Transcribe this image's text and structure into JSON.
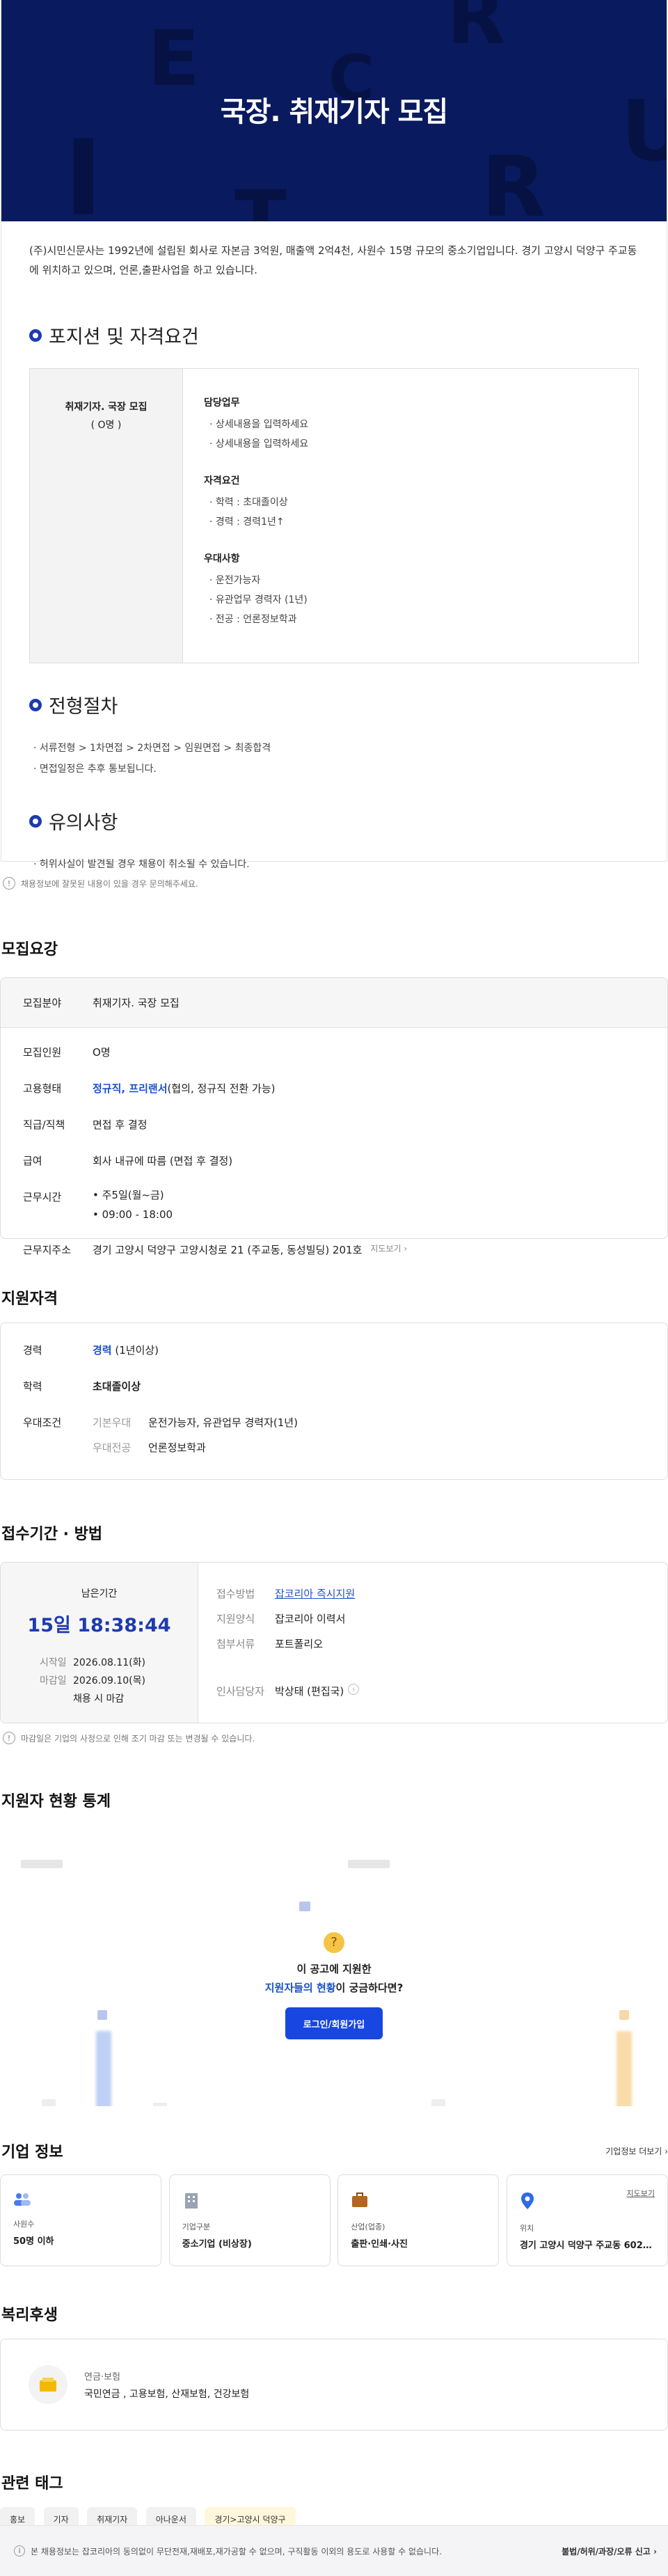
{
  "banner": {
    "title": "국장. 취재기자 모집",
    "letters": [
      "E",
      "R",
      "C",
      "I",
      "R",
      "U",
      "T"
    ]
  },
  "intro": "(주)시민신문사는 1992년에 설립된 회사로 자본금 3억원, 매출액 2억4천, 사원수 15명 규모의 중소기업입니다. 경기 고양시 덕양구 주교동에 위치하고 있으며, 언론,출판사업을 하고 있습니다.",
  "position": {
    "heading": "포지션 및 자격요건",
    "role": "취재기자. 국장 모집",
    "headcount": "( O명 )",
    "groups": [
      {
        "title": "담당업무",
        "items": [
          "상세내용을 입력하세요",
          "상세내용을 입력하세요"
        ]
      },
      {
        "title": "자격요건",
        "items": [
          "학력 : 초대졸이상",
          "경력 : 경력1년↑"
        ]
      },
      {
        "title": "우대사항",
        "items": [
          "운전가능자",
          "유관업무 경력자 (1년)",
          "전공 : 언론정보학과"
        ]
      }
    ]
  },
  "process": {
    "heading": "전형절차",
    "items": [
      "서류전형 > 1차면접 > 2차면접 > 임원면접 > 최종합격",
      "면접일정은 추후 통보됩니다."
    ]
  },
  "caution": {
    "heading": "유의사항",
    "items": [
      "허위사실이 발견될 경우 채용이 취소될 수 있습니다."
    ]
  },
  "notice": {
    "icon": "!",
    "text": "채용정보에 잘못된 내용이 있을 경우 문의해주세요."
  },
  "summary": {
    "heading": "모집요강",
    "field_label": "모집분야",
    "field_value": "취재기자. 국장 모집",
    "rows": {
      "headcount_k": "모집인원",
      "headcount_v": "O명",
      "type_k": "고용형태",
      "type_v_blue": "정규직, 프리랜서",
      "type_v_rest": "(협의, 정규직 전환 가능)",
      "rank_k": "직급/직책",
      "rank_v": "면접 후 결정",
      "salary_k": "급여",
      "salary_v": "회사 내규에 따름 (면접 후 결정)",
      "hours_k": "근무시간",
      "hours_v1": "주5일(월~금)",
      "hours_v2": "09:00 - 18:00",
      "addr_k": "근무지주소",
      "addr_v": "경기 고양시 덕양구 고양시청로 21 (주교동, 동성빌딩) 201호",
      "map_link": "지도보기"
    }
  },
  "qualification": {
    "heading": "지원자격",
    "career_k": "경력",
    "career_blue": "경력",
    "career_rest": "(1년이상)",
    "edu_k": "학력",
    "edu_v": "초대졸이상",
    "pref_k": "우대조건",
    "pref1_k": "기본우대",
    "pref1_v": "운전가능자, 유관업무 경력자(1년)",
    "pref2_k": "우대전공",
    "pref2_v": "언론정보학과"
  },
  "period": {
    "heading": "접수기간 · 방법",
    "remain_label": "남은기간",
    "remain_value": "15일 18:38:44",
    "start_k": "시작일",
    "start_v": "2026.08.11(화)",
    "end_k": "마감일",
    "end_v": "2026.09.10(목)",
    "end_note": "채용 시 마감",
    "method_k": "접수방법",
    "method_v": "잡코리아 즉시지원",
    "form_k": "지원양식",
    "form_v": "잡코리아 이력서",
    "docs_k": "첨부서류",
    "docs_v": "포트폴리오",
    "contact_k": "인사담당자",
    "contact_v": "박상태 (편집국)",
    "footnote": "마감일은 기업의 사정으로 인해 조기 마감 또는 변경될 수 있습니다."
  },
  "stats": {
    "heading": "지원자 현황 통계",
    "q1": "이 공고에 지원한",
    "q2_blue": "지원자들의 현황",
    "q2_rest": "이 궁금하다면?",
    "login_btn": "로그인/회원가입",
    "accent": "#1746e0"
  },
  "company": {
    "heading": "기업 정보",
    "more": "기업정보 더보기",
    "cards": [
      {
        "icon": "people-icon",
        "label": "사원수",
        "value": "50명 이하"
      },
      {
        "icon": "building-icon",
        "label": "기업구분",
        "value": "중소기업 (비상장)"
      },
      {
        "icon": "briefcase-icon",
        "label": "산업(업종)",
        "value": "출판·인쇄·사진"
      },
      {
        "icon": "location-icon",
        "label": "위치",
        "value": "경기 고양시 덕양구 주교동 602 ...",
        "link": "지도보기"
      }
    ]
  },
  "welfare": {
    "heading": "복리후생",
    "title": "연금·보험",
    "value": "국민연금 , 고용보험, 산재보험, 건강보험"
  },
  "tags": {
    "heading": "관련 태그",
    "items": [
      "홍보",
      "기자",
      "취재기자",
      "아나운서",
      "경기>고양시 덕양구"
    ]
  },
  "footer": {
    "text": "본 채용정보는 잡코리아의 동의없이 무단전재,재배포,재가공할 수 없으며, 구직활동 이외의 용도로 사용할 수 없습니다.",
    "report": "불법/허위/과장/오류 신고"
  }
}
